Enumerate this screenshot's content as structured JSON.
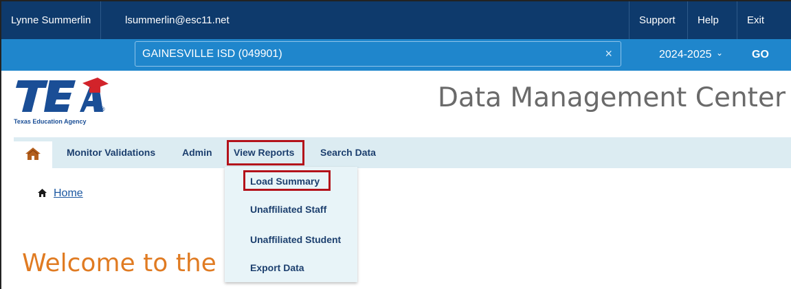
{
  "user": {
    "name": "Lynne Summerlin",
    "email": "lsummerlin@esc11.net"
  },
  "top_links": {
    "support": "Support",
    "help": "Help",
    "exit": "Exit"
  },
  "district": {
    "value": "GAINESVILLE ISD (049901)",
    "clear_symbol": "×"
  },
  "year": {
    "value": "2024-2025",
    "chevron": "⌄"
  },
  "go_label": "GO",
  "logo": {
    "letters": "TEA",
    "subtitle": "Texas Education Agency",
    "registered": "®"
  },
  "app_title": "Data Management Center",
  "nav": {
    "home_icon": "home-icon",
    "items": [
      {
        "label": "Monitor Validations"
      },
      {
        "label": "Admin"
      },
      {
        "label": "View Reports"
      },
      {
        "label": "Search Data"
      }
    ]
  },
  "dropdown": {
    "items": [
      {
        "label": "Load Summary"
      },
      {
        "label": "Unaffiliated Staff"
      },
      {
        "label": "Unaffiliated Student"
      },
      {
        "label": "Export Data"
      }
    ]
  },
  "breadcrumb": {
    "home": "Home"
  },
  "welcome": "Welcome to the",
  "colors": {
    "user_bar": "#0e3a6c",
    "district_bar": "#1f86cc",
    "nav_bg": "#dcecf2",
    "highlight": "#b3121a",
    "welcome": "#e07b22",
    "logo_red": "#d2232a"
  }
}
